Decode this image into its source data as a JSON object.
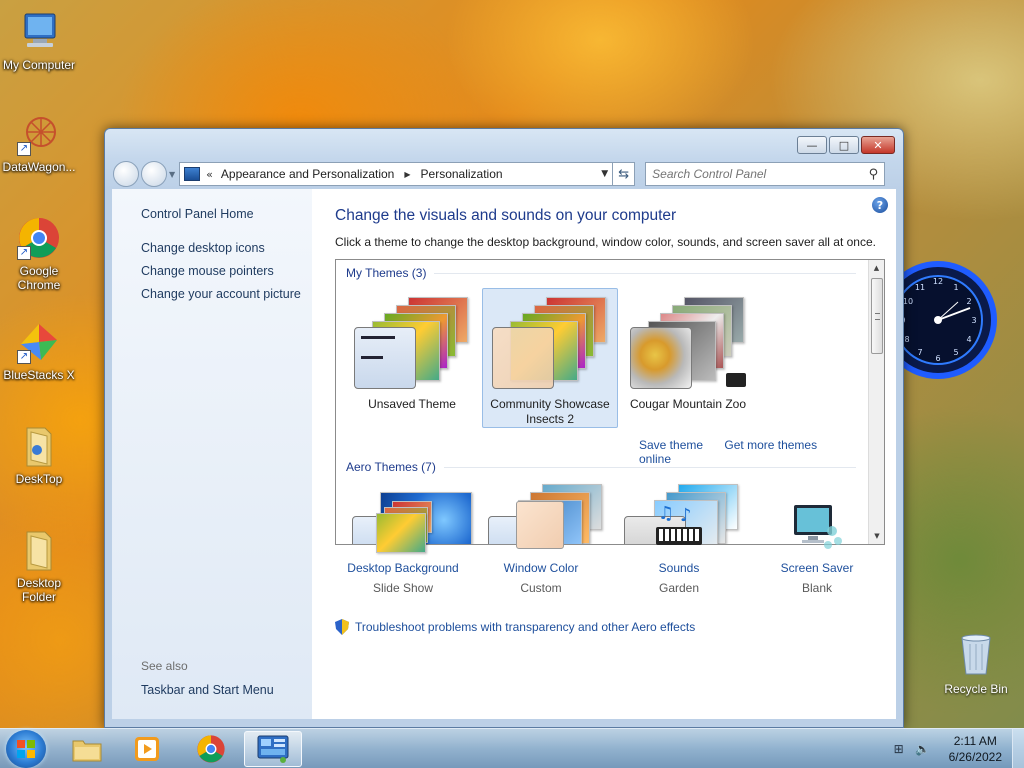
{
  "desktop": {
    "icons": [
      {
        "label": "My Computer"
      },
      {
        "label": "DataWagon..."
      },
      {
        "label": "Google Chrome"
      },
      {
        "label": "BlueStacks X"
      },
      {
        "label": "DeskTop"
      },
      {
        "label": "Desktop Folder"
      }
    ],
    "recycle_bin": {
      "label": "Recycle Bin"
    }
  },
  "window": {
    "caption": {
      "minimize": "—",
      "maximize": "□",
      "close": "✕"
    },
    "address": {
      "chevron": "«",
      "segments": [
        "Appearance and Personalization",
        "Personalization"
      ]
    },
    "search": {
      "placeholder": "Search Control Panel"
    },
    "left_pane": {
      "home": "Control Panel Home",
      "links": [
        "Change desktop icons",
        "Change mouse pointers",
        "Change your account picture"
      ],
      "see_also": "See also",
      "see_also_links": [
        "Taskbar and Start Menu"
      ]
    },
    "main": {
      "title": "Change the visuals and sounds on your computer",
      "description": "Click a theme to change the desktop background, window color, sounds, and screen saver all at once.",
      "groups": [
        {
          "title": "My Themes (3)"
        },
        {
          "title": "Aero Themes (7)"
        }
      ],
      "my_themes": [
        {
          "label": "Unsaved Theme"
        },
        {
          "label": "Community Showcase Insects 2",
          "selected": true
        },
        {
          "label": "Cougar Mountain Zoo"
        }
      ],
      "theme_links": {
        "save": "Save theme",
        "more": "Get more themes online"
      },
      "customize": [
        {
          "label": "Desktop Background",
          "value": "Slide Show"
        },
        {
          "label": "Window Color",
          "value": "Custom"
        },
        {
          "label": "Sounds",
          "value": "Garden"
        },
        {
          "label": "Screen Saver",
          "value": "Blank"
        }
      ],
      "troubleshoot": "Troubleshoot problems with transparency and other Aero effects"
    }
  },
  "taskbar": {
    "clock": {
      "time": "2:11 AM",
      "date": "6/26/2022"
    }
  },
  "colors": {
    "link": "#1e4f9c",
    "title": "#1e3b8c",
    "selected_bg": "#dbe8f7"
  }
}
